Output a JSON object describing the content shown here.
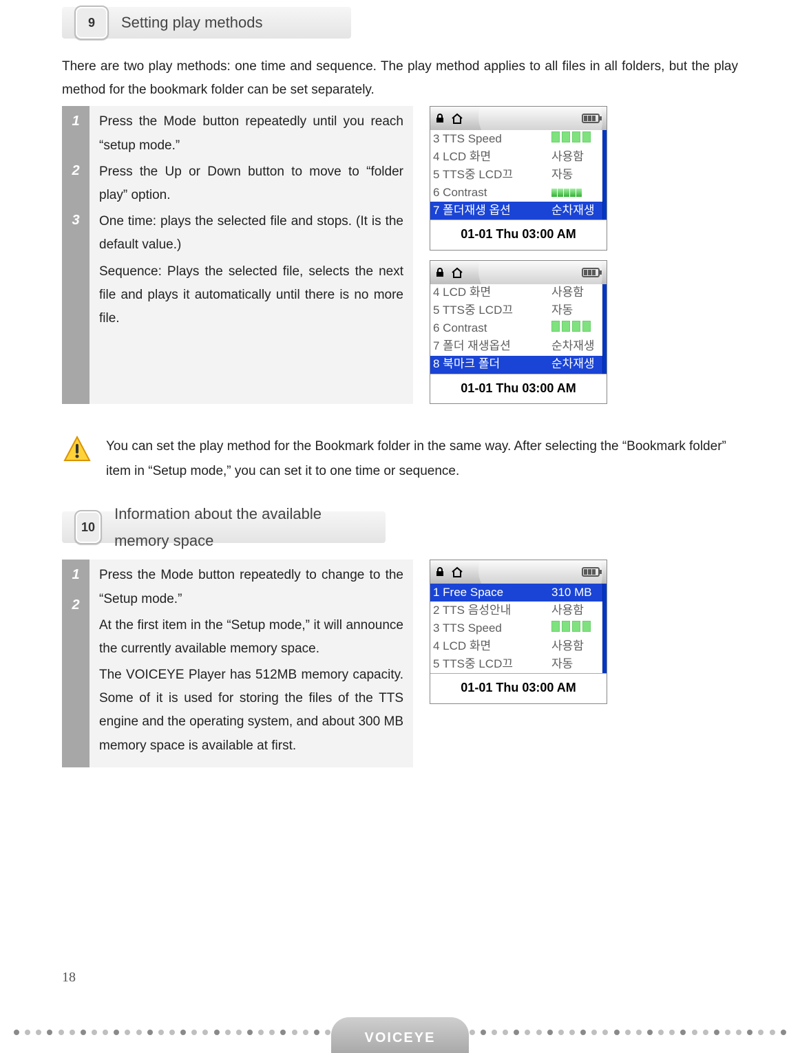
{
  "page_number": "18",
  "brand": "VOICEYE",
  "sections": {
    "nine": {
      "num": "9",
      "title": "Setting play methods",
      "intro": "There are two play methods: one time and sequence. The play method applies to all files in all folders, but the play method for the bookmark folder can be set separately.",
      "steps": {
        "n1": "1",
        "n2": "2",
        "n3": "3",
        "s1": "Press the Mode button repeatedly until you reach “setup mode.”",
        "s2": "Press the Up or Down button to move to “folder play” option.",
        "s3a": "One time: plays the selected file and stops. (It is the default value.)",
        "s3b": "Sequence: Plays the selected file, selects the next file and plays it automatically until there is no more file."
      }
    },
    "ten": {
      "num": "10",
      "title": "Information about the available memory space",
      "steps": {
        "n1": "1",
        "n2": "2",
        "s1": "Press the Mode button repeatedly to change to the “Setup mode.”",
        "s2": "At the first item in the “Setup mode,” it will announce the currently available memory space.",
        "s3": "The VOICEYE Player has 512MB memory capacity. Some of it is used for storing the files of the TTS engine and the operating system, and about 300 MB memory space is available at first."
      }
    }
  },
  "note": "You can set the play method for the Bookmark folder in the same way.   After selecting the “Bookmark folder” item in “Setup mode,” you can set it to one time or sequence.",
  "screens": {
    "time": "01-01  Thu   03:00 AM",
    "a": {
      "r1l": "3 TTS Speed",
      "r1r": "bars",
      "r2l": "4 LCD 화면",
      "r2r": "사용함",
      "r3l": "5 TTS중 LCD끄",
      "r3r": "자동",
      "r4l": "6 Contrast",
      "r4r": "contrast",
      "r5l": "7 폴더재생 옵션",
      "r5r": "순차재생"
    },
    "b": {
      "r1l": "4 LCD 화면",
      "r1r": "사용함",
      "r2l": "5 TTS중 LCD끄",
      "r2r": "자동",
      "r3l": "6 Contrast",
      "r3r": "bars",
      "r4l": "7 폴더 재생옵션",
      "r4r": "순차재생",
      "r5l": "8 북마크 폴더",
      "r5r": "순차재생"
    },
    "c": {
      "r1l": "1 Free Space",
      "r1r": "310 MB",
      "r2l": "2 TTS 음성안내",
      "r2r": "사용함",
      "r3l": "3 TTS Speed",
      "r3r": "bars",
      "r4l": "4 LCD 화면",
      "r4r": "사용함",
      "r5l": "5 TTS중 LCD끄",
      "r5r": "자동"
    }
  }
}
